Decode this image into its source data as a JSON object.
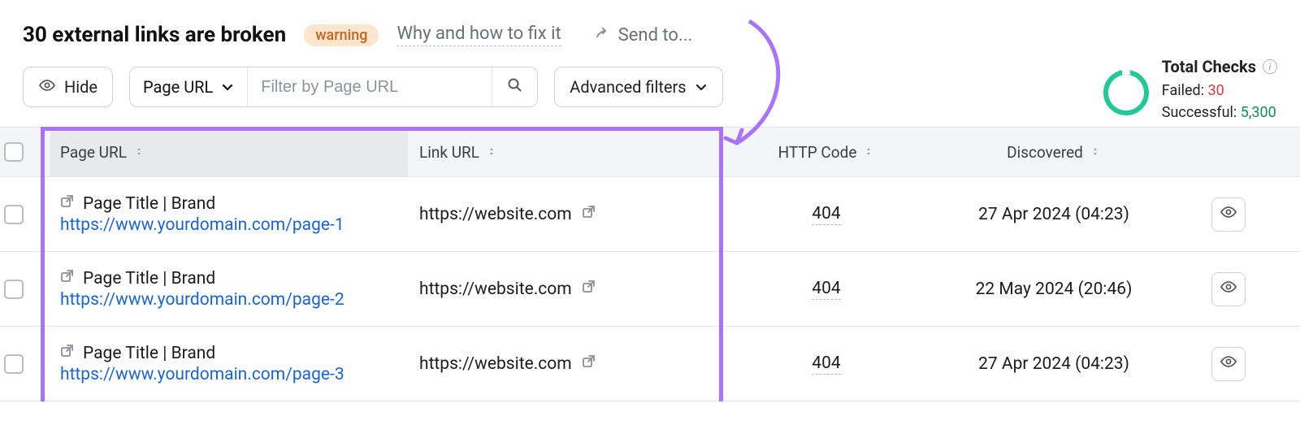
{
  "header": {
    "title": "30 external links are broken",
    "badge": "warning",
    "why_link": "Why and how to fix it",
    "send_to": "Send to..."
  },
  "toolbar": {
    "hide_label": "Hide",
    "filter_dropdown": "Page URL",
    "filter_placeholder": "Filter by Page URL",
    "advanced_filters": "Advanced filters"
  },
  "stats": {
    "label": "Total Checks",
    "failed_label": "Failed:",
    "failed_value": "30",
    "success_label": "Successful:",
    "success_value": "5,300"
  },
  "columns": {
    "page": "Page URL",
    "link": "Link URL",
    "code": "HTTP Code",
    "disc": "Discovered"
  },
  "rows": [
    {
      "page_title": "Page Title | Brand",
      "page_url": "https://www.yourdomain.com/page-1",
      "link_url": "https://website.com",
      "http_code": "404",
      "discovered": "27 Apr 2024 (04:23)"
    },
    {
      "page_title": "Page Title | Brand",
      "page_url": "https://www.yourdomain.com/page-2",
      "link_url": "https://website.com",
      "http_code": "404",
      "discovered": "22 May 2024 (20:46)"
    },
    {
      "page_title": "Page Title | Brand",
      "page_url": "https://www.yourdomain.com/page-3",
      "link_url": "https://website.com",
      "http_code": "404",
      "discovered": "27 Apr 2024 (04:23)"
    }
  ]
}
